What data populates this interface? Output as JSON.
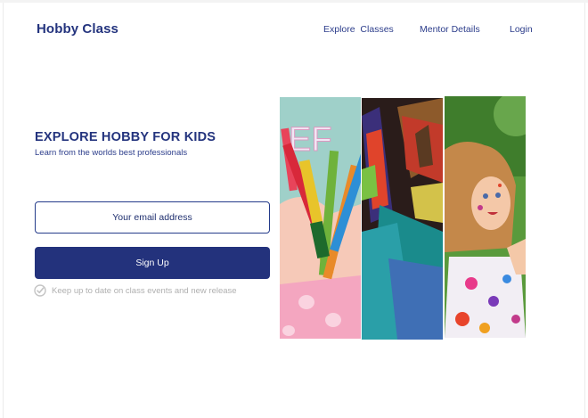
{
  "nav": {
    "brand": "Hobby Class",
    "links": [
      {
        "label": "Explore  Classes"
      },
      {
        "label": "Mentor Details"
      },
      {
        "label": "Login"
      }
    ]
  },
  "hero": {
    "title": "EXPLORE HOBBY FOR KIDS",
    "subtitle": "Learn from the worlds best professionals"
  },
  "signup": {
    "email_placeholder": "Your email address",
    "email_value": "",
    "button_label": "Sign Up",
    "note": "Keep up to date on class events and new release"
  },
  "icons": {
    "note_icon": "check-circle-icon"
  },
  "colors": {
    "brand": "#24347e",
    "button": "#23327c",
    "muted": "#b0b0b0"
  }
}
